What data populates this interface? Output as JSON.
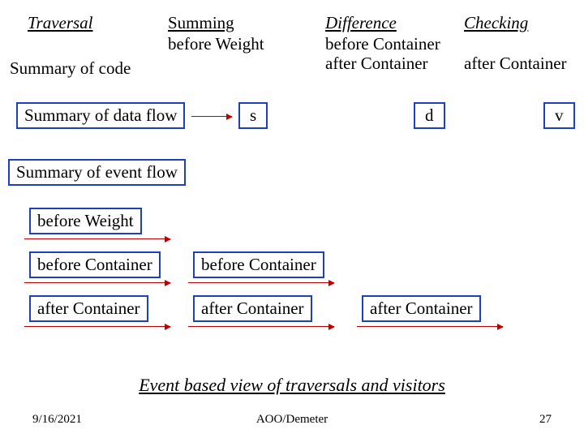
{
  "headings": {
    "traversal": "Traversal",
    "summing": "Summing",
    "summing_sub": "before Weight",
    "difference": "Difference",
    "difference_sub1": "before Container",
    "difference_sub2": "after Container",
    "checking": "Checking",
    "checking_sub": "after Container"
  },
  "summary_of_code": "Summary of code",
  "box_summary_data_flow": "Summary of data flow",
  "letters": {
    "s": "s",
    "d": "d",
    "v": "v"
  },
  "box_summary_event_flow": "Summary of event flow",
  "events": {
    "before_weight": "before Weight",
    "before_container_l": "before Container",
    "before_container_r": "before Container",
    "after_container_l": "after Container",
    "after_container_m": "after Container",
    "after_container_r": "after Container"
  },
  "caption": "Event  based view of traversals and visitors",
  "footer": {
    "date": "9/16/2021",
    "center": "AOO/Demeter",
    "page": "27"
  },
  "colors": {
    "box_border": "#1e3fbf",
    "arrow": "#c00000"
  }
}
